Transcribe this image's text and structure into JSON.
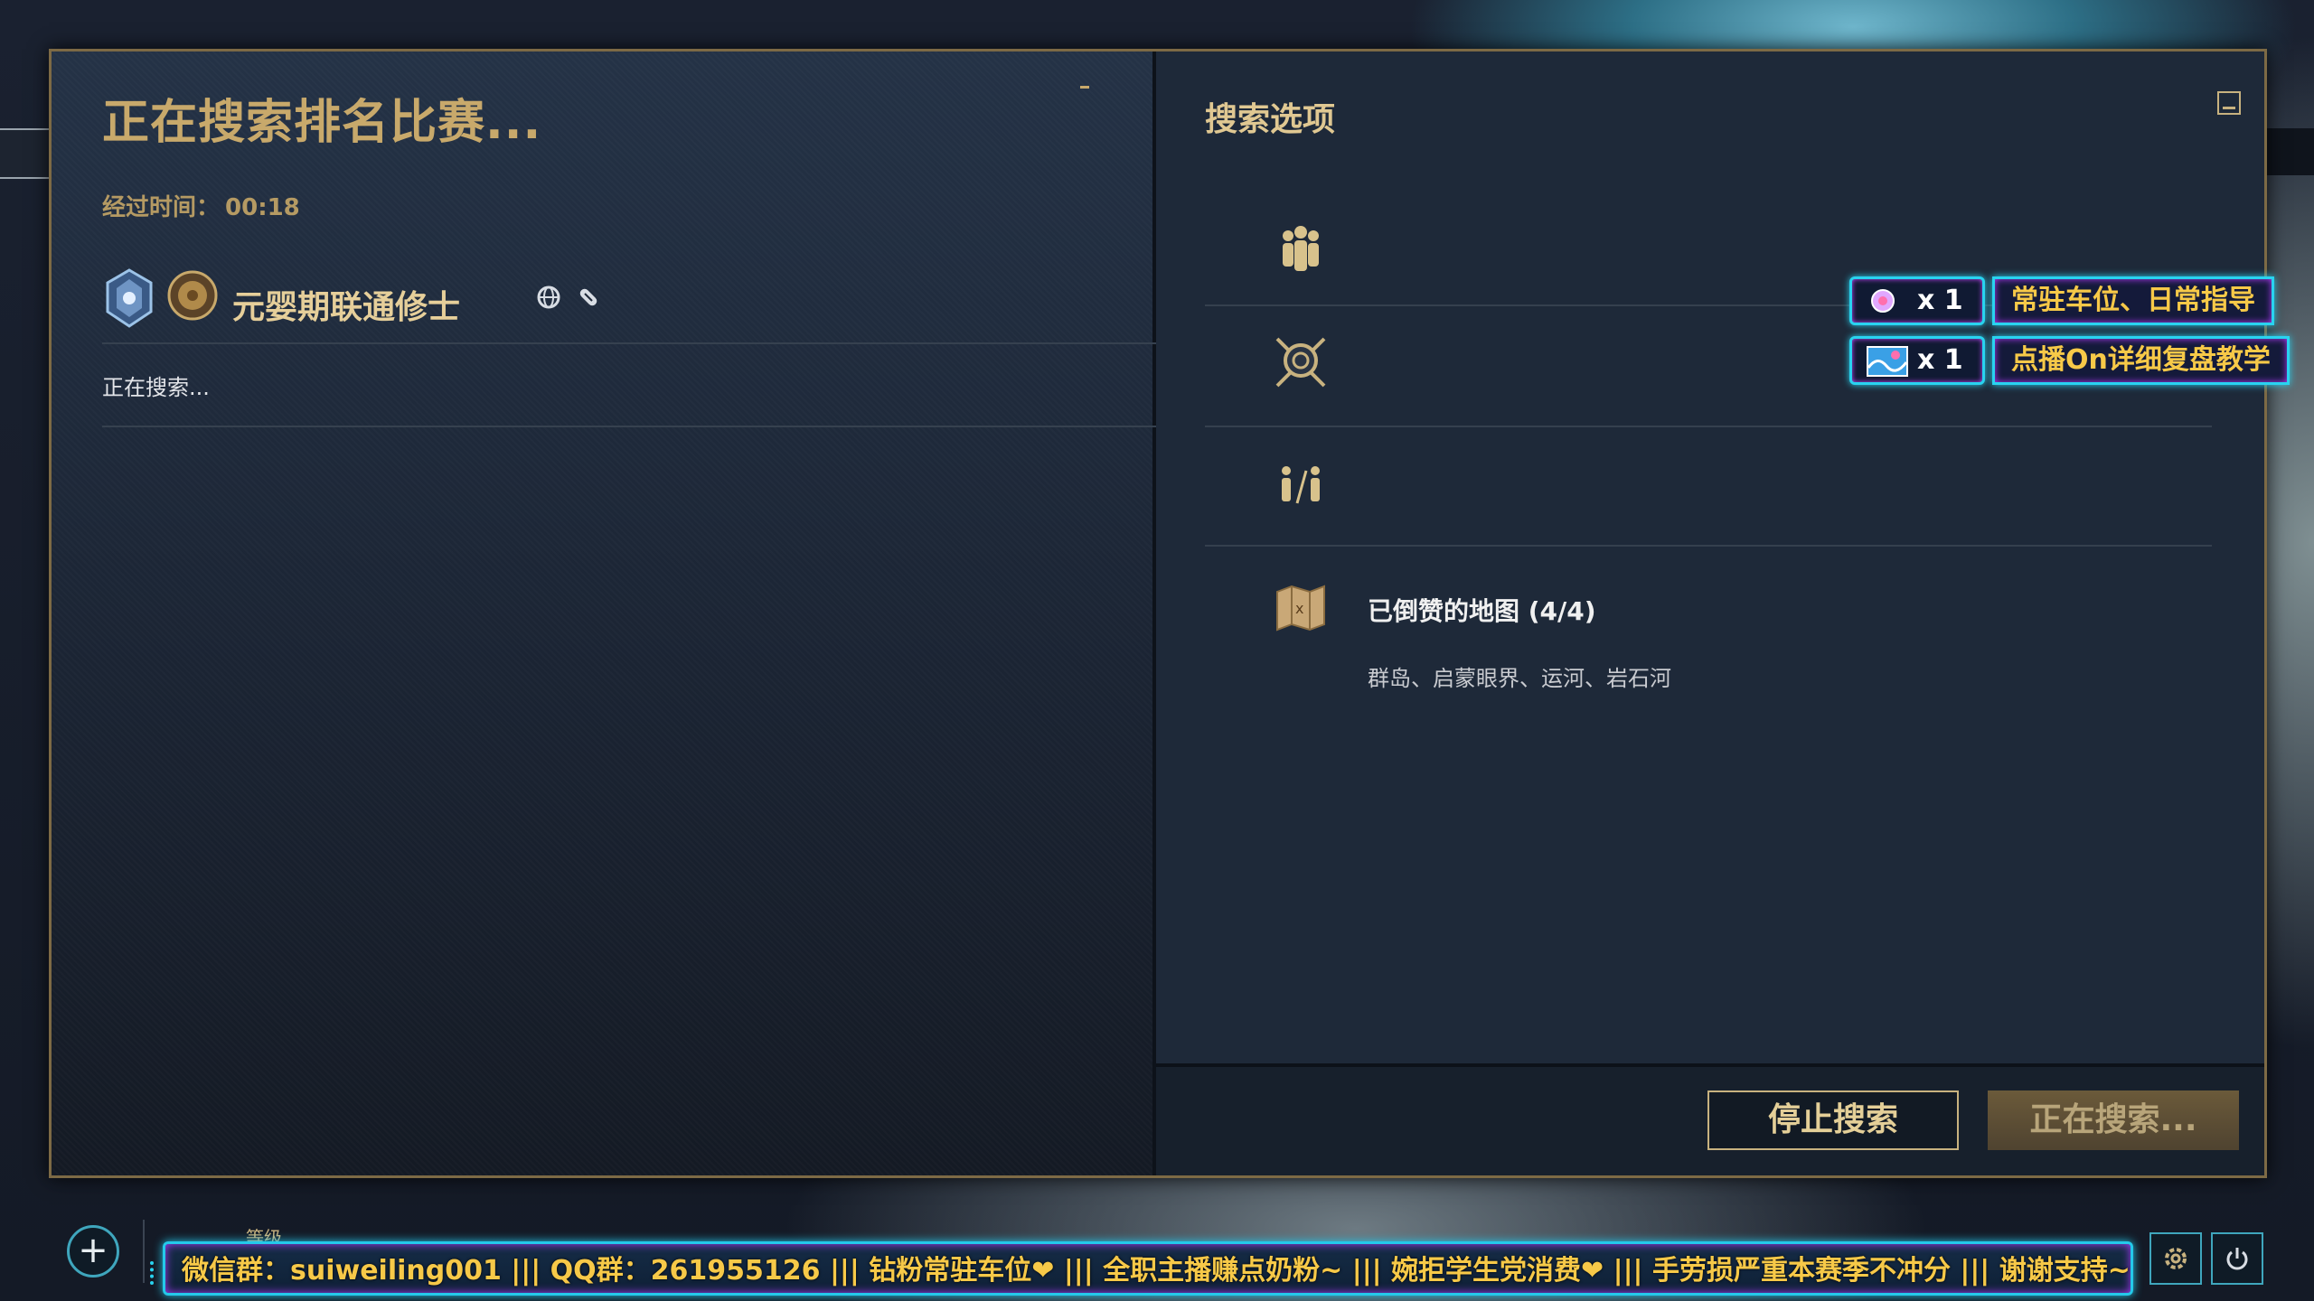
{
  "queue": {
    "title": "正在搜索排名比赛...",
    "elapsed_label": "经过时间：",
    "elapsed_value": "00:18",
    "status": "正在搜索..."
  },
  "player": {
    "name": "元婴期联通修士",
    "icons": [
      "rank-emblem-icon",
      "avatar-icon",
      "globe-icon",
      "pill-icon"
    ]
  },
  "options": {
    "title": "搜索选项",
    "rows": [
      {
        "icon": "party-icon"
      },
      {
        "icon": "role-shield-icon"
      },
      {
        "icon": "players-per-team-icon"
      },
      {
        "icon": "map-icon",
        "title": "已倒赞的地图 (4/4)",
        "detail": "群岛、启蒙眼界、运河、岩石河"
      }
    ]
  },
  "footer": {
    "stop_label": "停止搜索",
    "searching_label": "正在搜索..."
  },
  "stream_badges": [
    {
      "count": "x 1",
      "label": "常驻车位、日常指导"
    },
    {
      "count": "x 1",
      "label": "点播On详细复盘教学"
    }
  ],
  "bottom_bar": {
    "plus_label": "+",
    "level_label": "等级",
    "ticker": "微信群：suiweiling001 ||| QQ群：261955126 ||| 钻粉常驻车位❤ ||| 全职主播赚点奶粉~ ||| 婉拒学生党消费❤ ||| 手劳损严重本赛季不冲分 ||| 谢谢支持~❤"
  },
  "colors": {
    "gold": "#c8a96b",
    "panel": "#1e2939",
    "neon_cyan": "#29d3f0",
    "neon_purple": "#b63bff",
    "ticker_text": "#f7c948"
  }
}
